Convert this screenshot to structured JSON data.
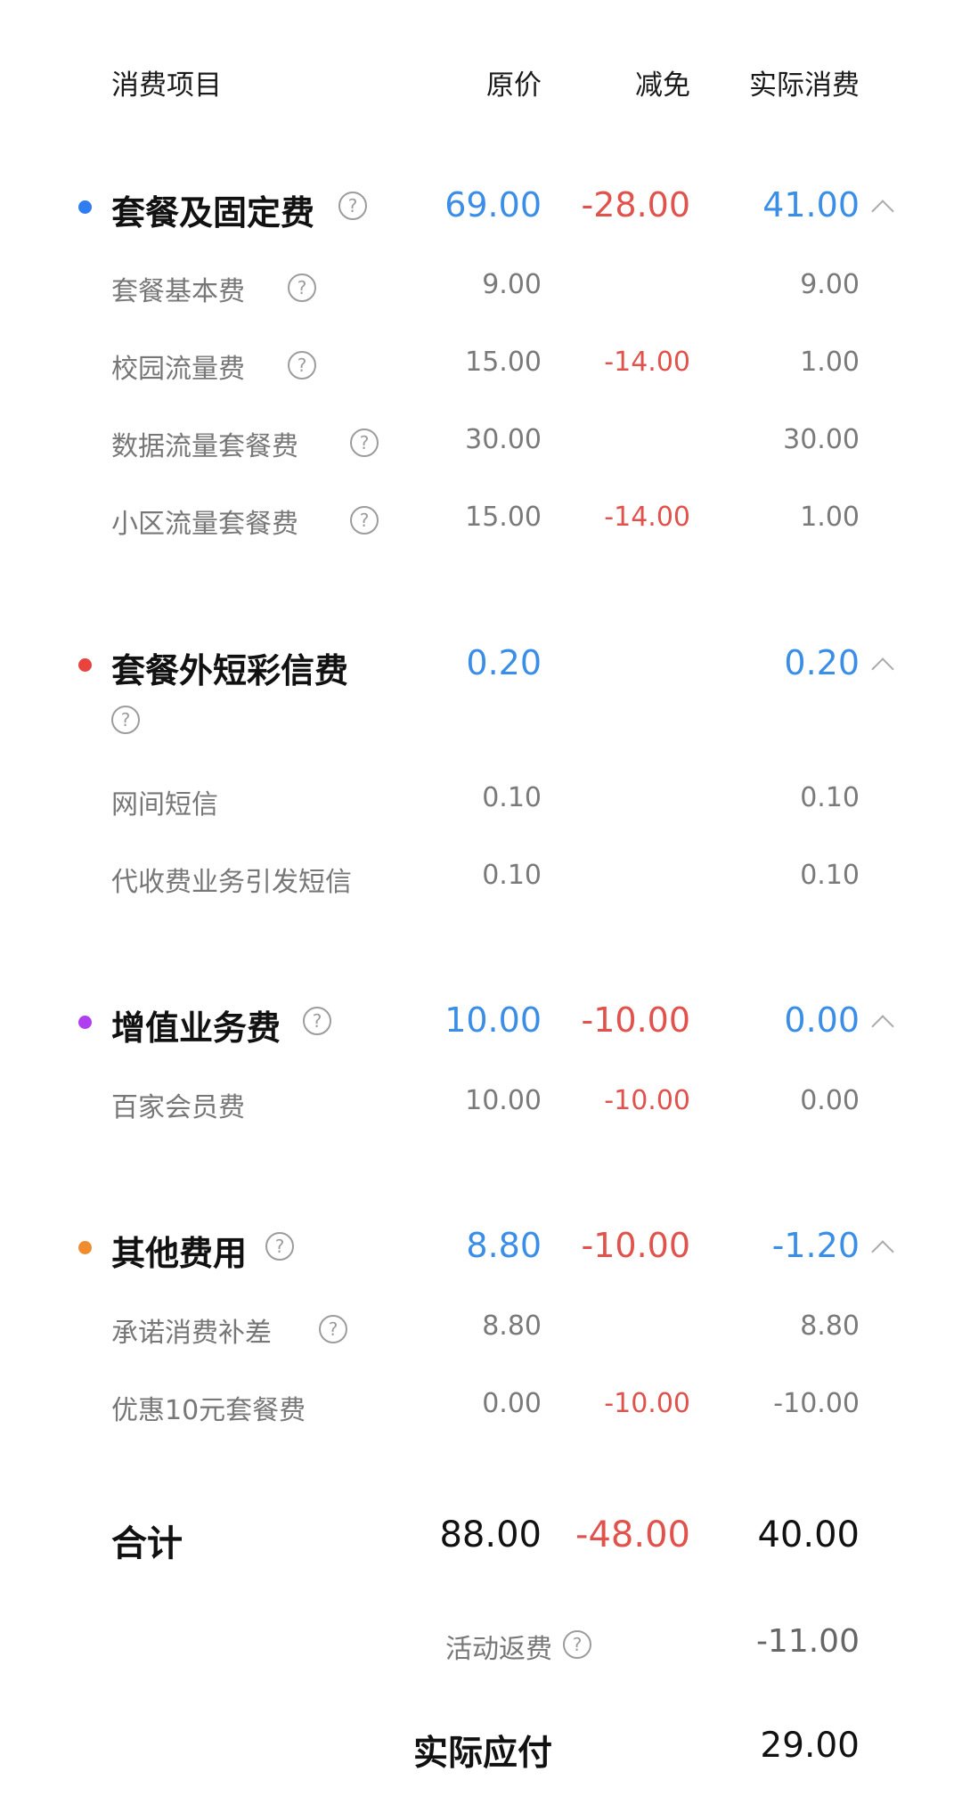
{
  "header": {
    "item": "消费项目",
    "orig": "原价",
    "reduction": "减免",
    "actual": "实际消费"
  },
  "categories": [
    {
      "name": "套餐及固定费",
      "orig": "69.00",
      "reduction": "-28.00",
      "actual": "41.00",
      "dot_color": "#2f7df0",
      "items": [
        {
          "name": "套餐基本费",
          "orig": "9.00",
          "reduction": "",
          "actual": "9.00"
        },
        {
          "name": "校园流量费",
          "orig": "15.00",
          "reduction": "-14.00",
          "actual": "1.00"
        },
        {
          "name": "数据流量套餐费",
          "orig": "30.00",
          "reduction": "",
          "actual": "30.00"
        },
        {
          "name": "小区流量套餐费",
          "orig": "15.00",
          "reduction": "-14.00",
          "actual": "1.00"
        }
      ]
    },
    {
      "name": "套餐外短彩信费",
      "orig": "0.20",
      "reduction": "",
      "actual": "0.20",
      "dot_color": "#e8433e",
      "items": [
        {
          "name": "网间短信",
          "orig": "0.10",
          "reduction": "",
          "actual": "0.10"
        },
        {
          "name": "代收费业务引发短信",
          "orig": "0.10",
          "reduction": "",
          "actual": "0.10"
        }
      ]
    },
    {
      "name": "增值业务费",
      "orig": "10.00",
      "reduction": "-10.00",
      "actual": "0.00",
      "dot_color": "#b03ff0",
      "items": [
        {
          "name": "百家会员费",
          "orig": "10.00",
          "reduction": "-10.00",
          "actual": "0.00"
        }
      ]
    },
    {
      "name": "其他费用",
      "orig": "8.80",
      "reduction": "-10.00",
      "actual": "-1.20",
      "dot_color": "#f08c30",
      "items": [
        {
          "name": "承诺消费补差",
          "orig": "8.80",
          "reduction": "",
          "actual": "8.80"
        },
        {
          "name": "优惠10元套餐费",
          "orig": "0.00",
          "reduction": "-10.00",
          "actual": "-10.00"
        }
      ]
    }
  ],
  "total": {
    "label": "合计",
    "orig": "88.00",
    "reduction": "-48.00",
    "actual": "40.00"
  },
  "rebate": {
    "label": "活动返费",
    "value": "-11.00"
  },
  "payable": {
    "label": "实际应付",
    "value": "29.00"
  },
  "icons": {
    "help": "?",
    "collapse": "chevron-up-icon"
  }
}
